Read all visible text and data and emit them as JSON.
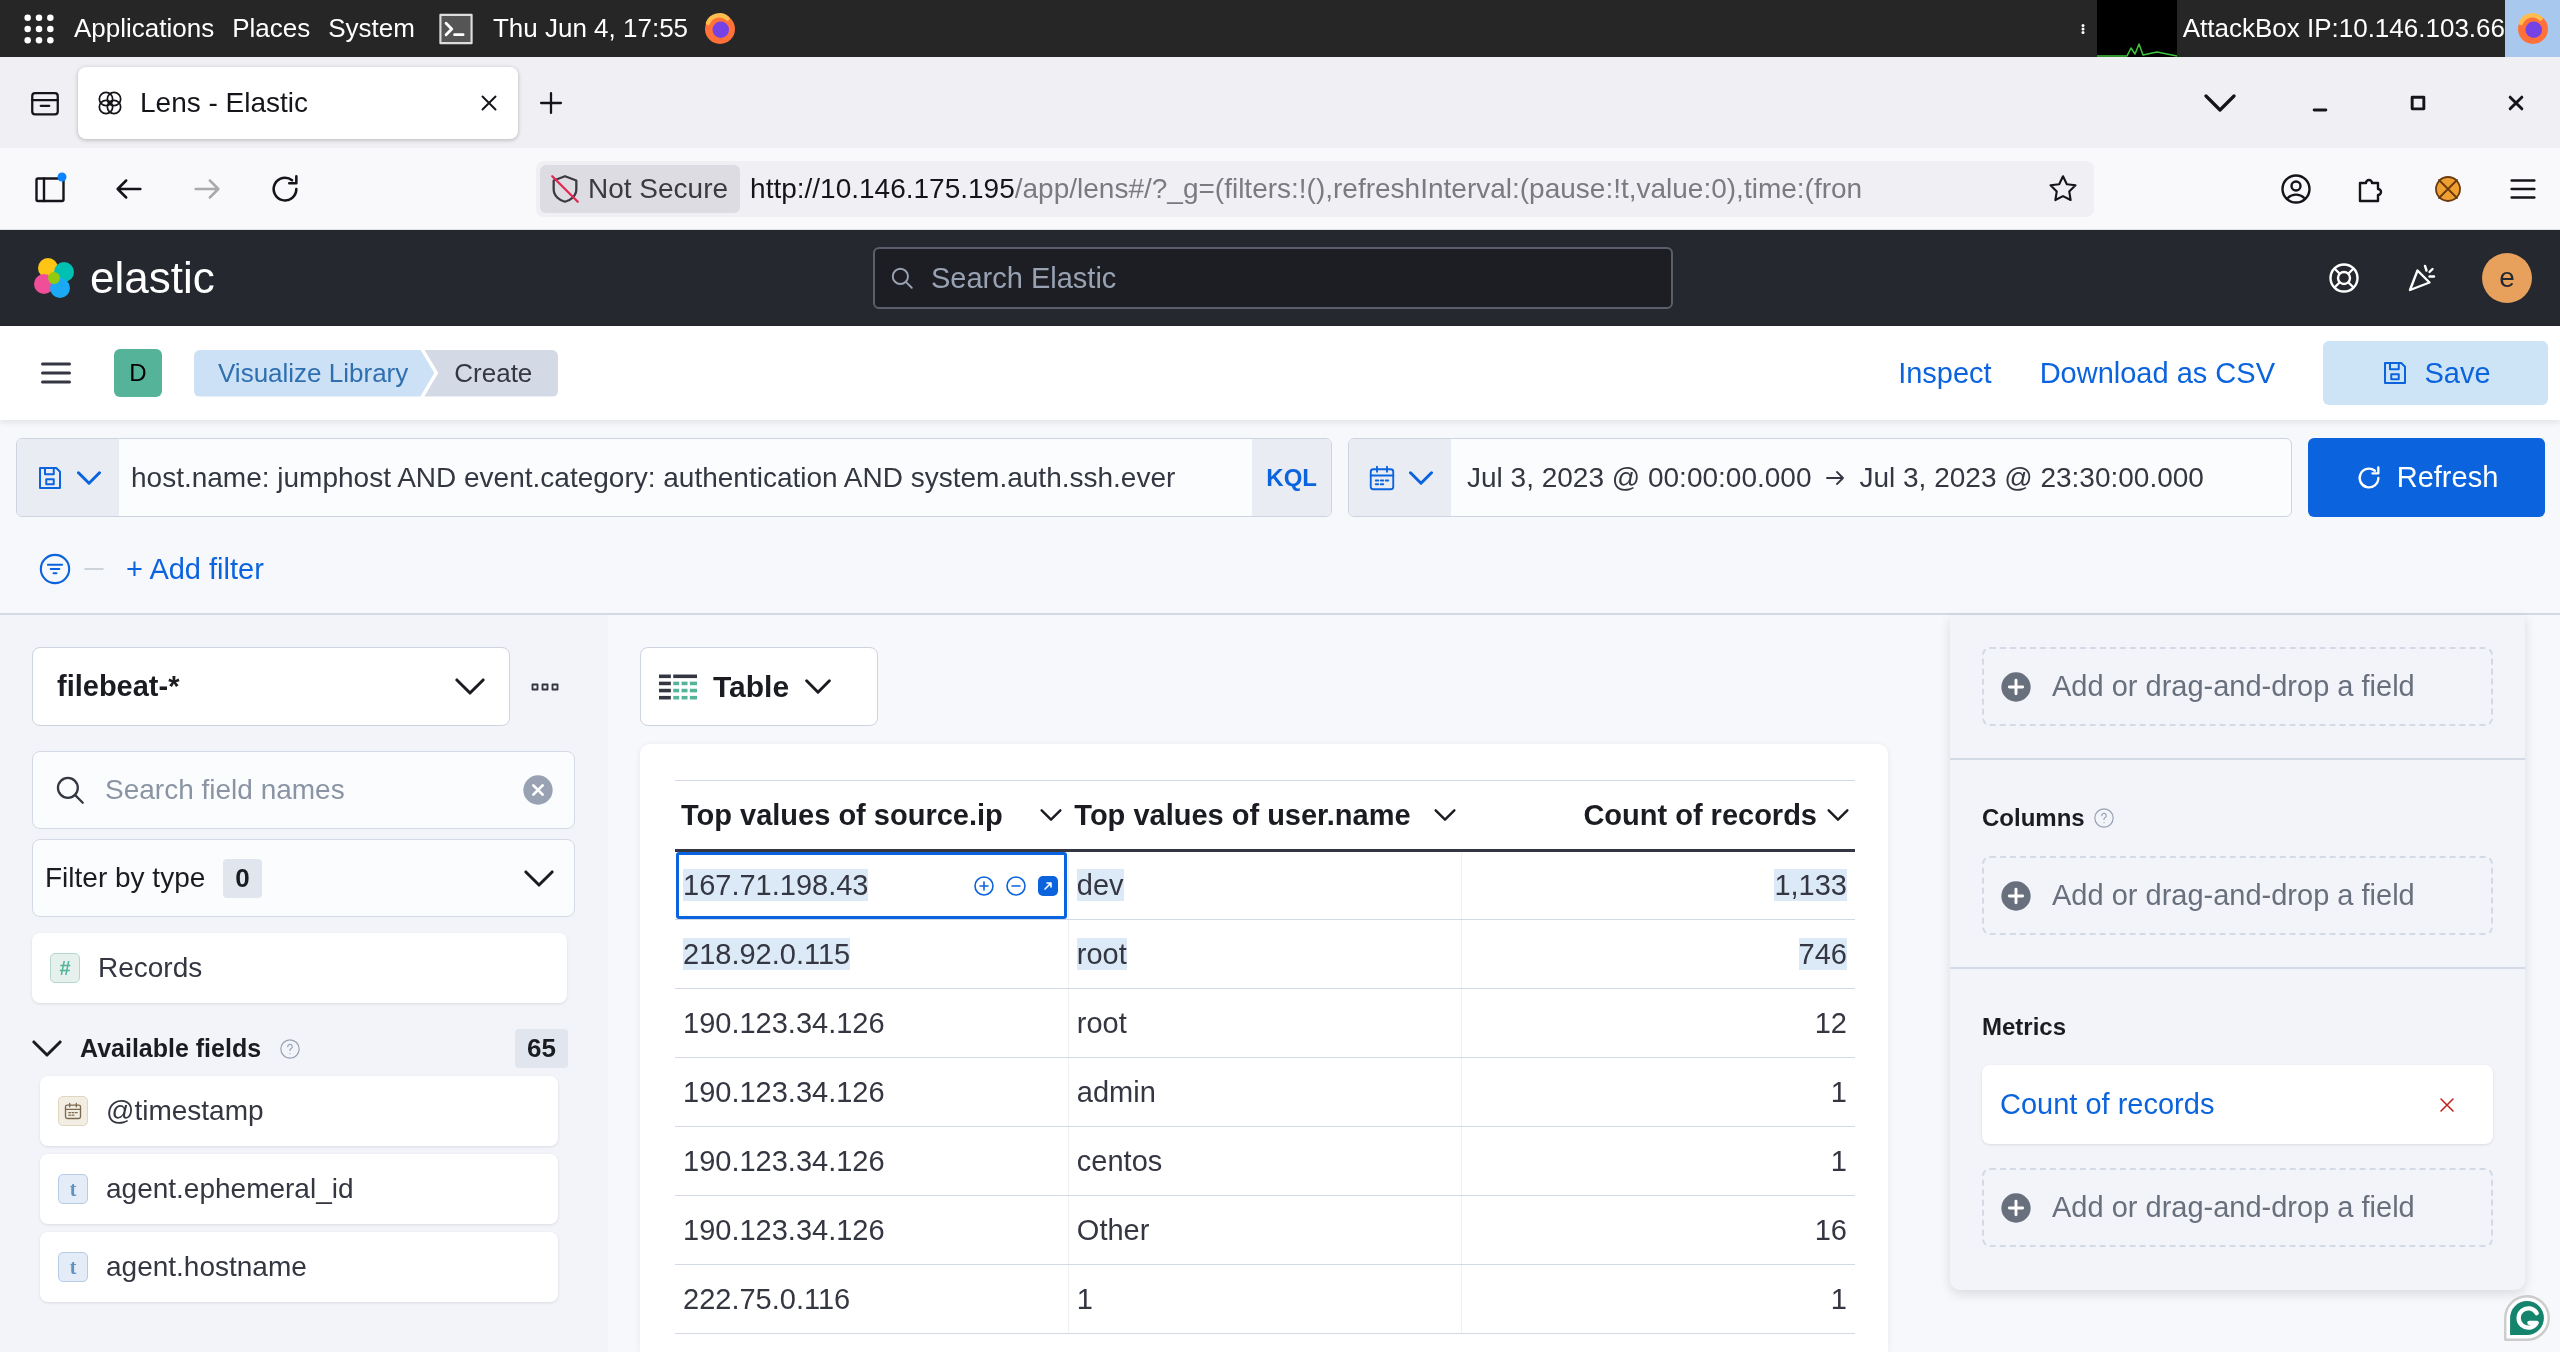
{
  "os_bar": {
    "menus": [
      "Applications",
      "Places",
      "System"
    ],
    "clock": "Thu Jun  4, 17:55",
    "attackbox": "AttackBox IP:10.146.103.66"
  },
  "browser": {
    "tabs": [
      {
        "title": "Lens - Elastic",
        "selected": true
      }
    ],
    "security": "Not Secure",
    "url_host": "http://10.146.175.195",
    "url_path": "/app/lens#/?_g=(filters:!(),refreshInterval:(pause:!t,value:0),time:(fron"
  },
  "header": {
    "logo": "elastic",
    "search": {
      "placeholder": "Search Elastic"
    },
    "avatar": "e"
  },
  "toolbar": {
    "space": "D",
    "breadcrumbs": [
      {
        "label": "Visualize Library",
        "selected": false
      },
      {
        "label": "Create",
        "selected": true
      }
    ],
    "actions": [
      "Inspect",
      "Download as CSV"
    ],
    "save": "Save"
  },
  "query": {
    "value": "host.name: jumphost AND event.category: authentication AND system.auth.ssh.ever",
    "language": "KQL",
    "start": "Jul 3, 2023 @ 00:00:00.000",
    "end": "Jul 3, 2023 @ 23:30:00.000",
    "refresh": "Refresh",
    "add_filter": "+ Add filter"
  },
  "sidebar": {
    "index_pattern": "filebeat-*",
    "search": {
      "placeholder": "Search field names"
    },
    "filter_by_type": {
      "label": "Filter by type",
      "count": "0"
    },
    "records": {
      "label": "Records",
      "kind": "number",
      "type_label": "#"
    },
    "available": {
      "label": "Available fields",
      "count": "65",
      "expanded": true,
      "help": true,
      "fields": [
        {
          "name": "@timestamp",
          "kind": "date"
        },
        {
          "name": "agent.ephemeral_id",
          "kind": "string",
          "type_label": "t"
        },
        {
          "name": "agent.hostname",
          "kind": "string",
          "type_label": "t"
        }
      ]
    }
  },
  "workspace": {
    "chart_type": "Table",
    "table": {
      "columns": [
        {
          "label": "Top values of source.ip",
          "kind": "bucket"
        },
        {
          "label": "Top values of user.name",
          "kind": "bucket"
        },
        {
          "label": "Count of records",
          "kind": "metric"
        }
      ],
      "rows": [
        {
          "cells": [
            "167.71.198.43",
            "dev",
            "1,133"
          ],
          "highlighted": true,
          "focused": true
        },
        {
          "cells": [
            "218.92.0.115",
            "root",
            "746"
          ],
          "highlighted": true,
          "focused": false
        },
        {
          "cells": [
            "190.123.34.126",
            "root",
            "12"
          ],
          "highlighted": false,
          "focused": false
        },
        {
          "cells": [
            "190.123.34.126",
            "admin",
            "1"
          ],
          "highlighted": false,
          "focused": false
        },
        {
          "cells": [
            "190.123.34.126",
            "centos",
            "1"
          ],
          "highlighted": false,
          "focused": false
        },
        {
          "cells": [
            "190.123.34.126",
            "Other",
            "16"
          ],
          "highlighted": false,
          "focused": false
        },
        {
          "cells": [
            "222.75.0.116",
            "1",
            "1"
          ],
          "highlighted": false,
          "focused": false
        }
      ]
    }
  },
  "config": {
    "sections": [
      {
        "items": [
          {
            "kind": "empty",
            "label": "Add or drag-and-drop a field"
          }
        ]
      },
      {
        "title": "Columns",
        "help": true,
        "items": [
          {
            "kind": "empty",
            "label": "Add or drag-and-drop a field"
          }
        ]
      },
      {
        "title": "Metrics",
        "items": [
          {
            "kind": "metric",
            "label": "Count of records"
          },
          {
            "kind": "empty",
            "label": "Add or drag-and-drop a field"
          }
        ]
      }
    ]
  }
}
